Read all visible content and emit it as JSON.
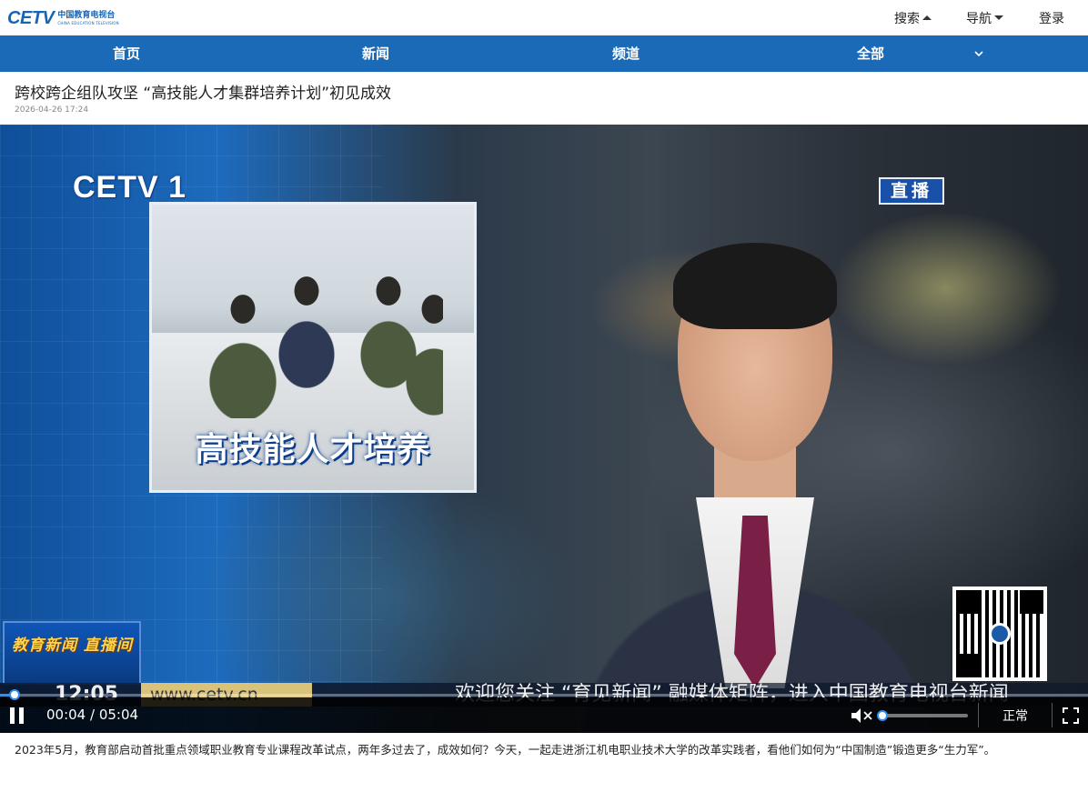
{
  "header": {
    "logo_mark": "CETV",
    "logo_cn": "中国教育电视台",
    "logo_en": "CHINA EDUCATION TELEVISION",
    "links": {
      "search": "搜索",
      "nav": "导航",
      "login": "登录"
    }
  },
  "navbar": {
    "items": [
      "首页",
      "新闻",
      "频道",
      "全部"
    ]
  },
  "article": {
    "title": "跨校跨企组队攻坚 “高技能人才集群培养计划”初见成效",
    "date": "2026-04-26 17:24",
    "description": "2023年5月，教育部启动首批重点领域职业教育专业课程改革试点，两年多过去了，成效如何？今天，一起走进浙江机电职业技术大学的改革实践者，看他们如何为“中国制造”锻造更多“生力军”。"
  },
  "video": {
    "channel_logo": "CETV 1",
    "live_badge": "直播",
    "inset_caption": "高技能人才培养",
    "news_tag": "教育新闻 直播间",
    "ticker_time": "12:05",
    "ticker_url": "www.cetv.cn",
    "ticker_text": "欢迎您关注 “育见新闻” 融媒体矩阵，进入中国教育电视台新闻",
    "controls": {
      "current_time": "00:04",
      "duration": "05:04",
      "time_display": "00:04 / 05:04",
      "progress_fraction": 0.0132,
      "volume_fraction": 0.0,
      "rate_label": "正常",
      "muted": true
    }
  },
  "colors": {
    "nav_blue": "#1b6ab7",
    "logo_blue": "#1664b4",
    "progress_blue": "#2f8fef"
  }
}
